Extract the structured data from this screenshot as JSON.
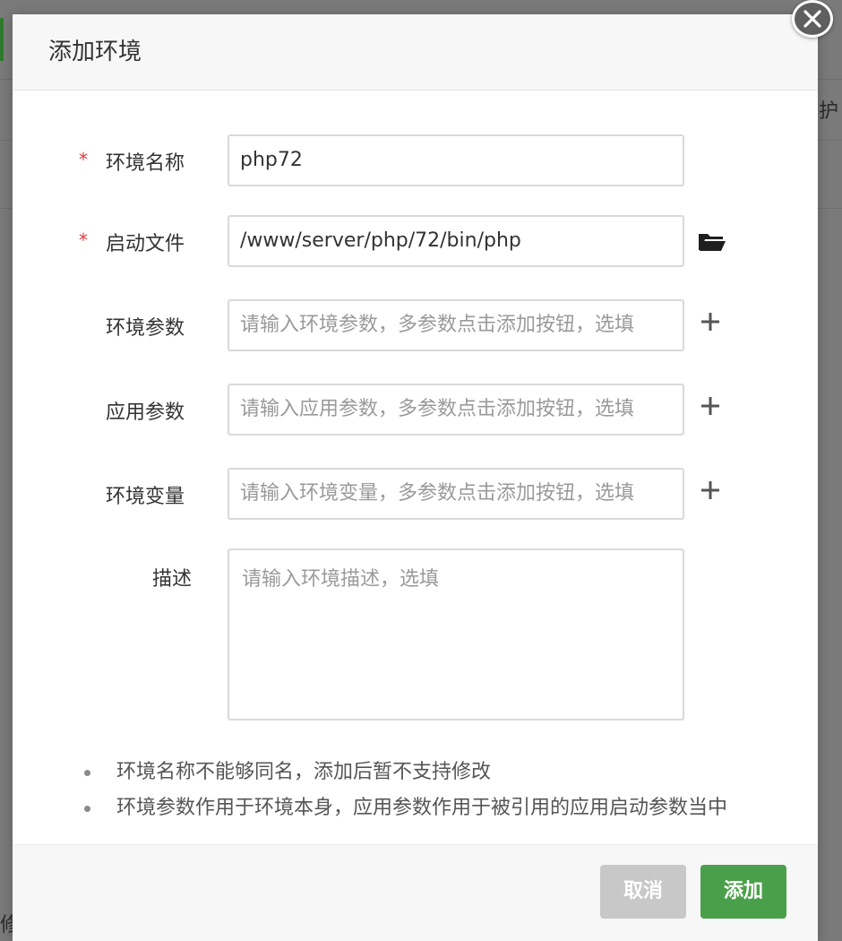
{
  "background": {
    "right_edge_text": "护",
    "bottom_left_text": "修"
  },
  "dialog": {
    "title": "添加环境",
    "close_icon": "close-icon"
  },
  "form": {
    "env_name": {
      "label": "环境名称",
      "required": "*",
      "value": "php72"
    },
    "start_file": {
      "label": "启动文件",
      "required": "*",
      "value": "/www/server/php/72/bin/php",
      "icon": "folder-open-icon"
    },
    "env_params": {
      "label": "环境参数",
      "placeholder": "请输入环境参数，多参数点击添加按钮，选填",
      "icon": "plus-icon"
    },
    "app_params": {
      "label": "应用参数",
      "placeholder": "请输入应用参数，多参数点击添加按钮，选填",
      "icon": "plus-icon"
    },
    "env_vars": {
      "label": "环境变量",
      "placeholder": "请输入环境变量，多参数点击添加按钮，选填",
      "icon": "plus-icon"
    },
    "description": {
      "label": "描述",
      "placeholder": "请输入环境描述，选填"
    }
  },
  "notes": [
    "环境名称不能够同名，添加后暂不支持修改",
    "环境参数作用于环境本身，应用参数作用于被引用的应用启动参数当中"
  ],
  "footer": {
    "cancel_label": "取消",
    "add_label": "添加"
  },
  "colors": {
    "primary": "#4aa04a",
    "cancel": "#c8c8c8",
    "required": "#e03a3a"
  }
}
